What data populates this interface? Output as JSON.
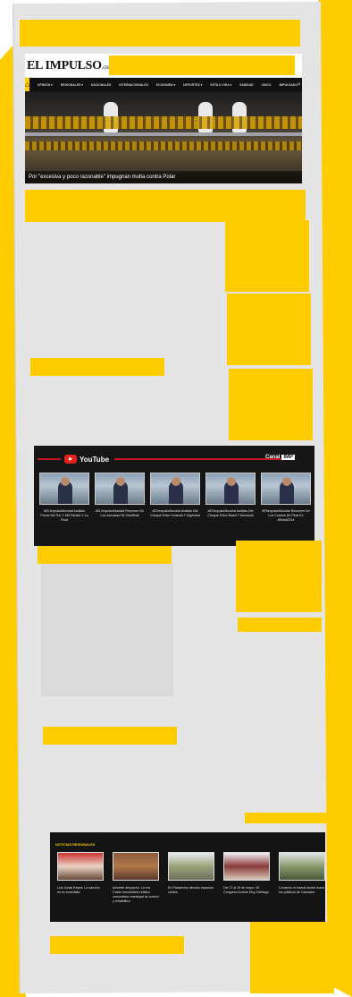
{
  "header": {
    "logo_text": "EL IMPULSO",
    "logo_suffix": ".com"
  },
  "nav": {
    "home_icon": "home-icon",
    "items": [
      "OPINIÓN ▾",
      "REGIONALES ▾",
      "NACIONALES",
      "INTERNACIONALES",
      "ECONOMÍA ▾",
      "DEPORTES ▾",
      "ESTILO VIDA ▾",
      "SANIDAD",
      "CINCO",
      "IMPULSADO"
    ],
    "search_icon": "search-icon"
  },
  "hero": {
    "caption": "Por \"excesiva y poco razonable\" impugnan multa contra Polar"
  },
  "youtube": {
    "brand": "YouTube",
    "canal_label": "Canal",
    "canal_logo": "IMP",
    "videos": [
      {
        "title": "#EL\\ImpulsoMundial Análisis Previo Del Ser Y #El Partido Y La Final"
      },
      {
        "title": "#EL\\ImpulsoMundial Resumen De Los Jornadas De Semifinal"
      },
      {
        "title": "#El\\ImpulsoMundial Análisis Del Choque Entre Holanda Y Argentina"
      },
      {
        "title": "#El\\ImpulsoMundial Análisis Del Choque Entre Brasil Y Alemania"
      },
      {
        "title": "#El\\ImpulsoMundial Resumen De Los Cuartos De Final En #Brasil2014"
      }
    ]
  },
  "regional": {
    "heading": "NOTICIAS REGIONALES",
    "items": [
      {
        "title": "Luis Jonás Reyes: La sanción no es inmediata"
      },
      {
        "title": "Advierte despacho: La era Colofo inmobiliario relativo comunitario municipal de control y rehabilitico"
      },
      {
        "title": "En Palavecino afectan espacios verdes"
      },
      {
        "title": "Del 17 al 19 de mayo: VII Congreso Andrés Eloy Zahlfugo"
      },
      {
        "title": "Consecro el tramal donde mana los públicos de Cabudare"
      }
    ]
  },
  "colors": {
    "accent": "#ffcc00",
    "nav_bg": "#111111",
    "youtube_red": "#e62117"
  }
}
